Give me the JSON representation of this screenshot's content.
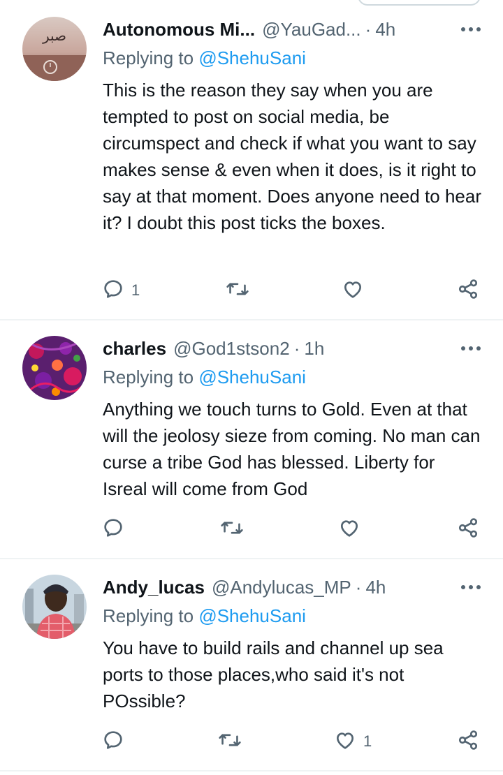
{
  "replies": [
    {
      "name": "Autonomous Mi...",
      "handle": "@YauGad...",
      "time": "4h",
      "replying_prefix": "Replying to ",
      "replying_to": "@ShehuSani",
      "text": "This is the reason they say when you are tempted to post on social media, be circumspect and check if what you want to say makes sense & even when it does, is it right to say at that moment. Does anyone need to hear it? I doubt this post ticks the boxes.",
      "reply_count": "1",
      "retweet_count": "",
      "like_count": "",
      "avatar_text": "صبر"
    },
    {
      "name": "charles",
      "handle": "@God1stson2",
      "time": "1h",
      "replying_prefix": "Replying to ",
      "replying_to": "@ShehuSani",
      "text": "Anything we touch turns to Gold. Even at that will the jeolosy sieze from coming. No man can curse a tribe God has blessed. Liberty for Isreal will come from God",
      "reply_count": "",
      "retweet_count": "",
      "like_count": ""
    },
    {
      "name": "Andy_lucas",
      "handle": "@Andylucas_MP",
      "time": "4h",
      "replying_prefix": "Replying to ",
      "replying_to": "@ShehuSani",
      "text": "You have to build rails and channel up sea ports to those places,who said it's not POssible?",
      "reply_count": "",
      "retweet_count": "",
      "like_count": "1"
    }
  ],
  "separator_dot": "·",
  "colors": {
    "text": "#0f1419",
    "muted": "#536471",
    "link": "#1d9bf0",
    "divider": "#eff3f4"
  },
  "icons": [
    "more-icon",
    "reply-icon",
    "retweet-icon",
    "like-icon",
    "share-icon"
  ]
}
